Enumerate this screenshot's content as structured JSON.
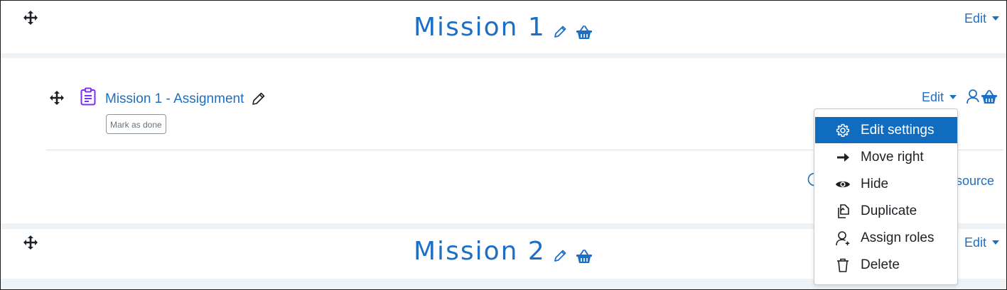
{
  "sections": [
    {
      "title": "Mission 1",
      "edit_label": "Edit"
    },
    {
      "title": "Mission 2",
      "edit_label": "Edit"
    }
  ],
  "activity": {
    "name": "Mission 1 - Assignment",
    "mark_done_label": "Mark as done",
    "edit_label": "Edit"
  },
  "add_activity_partial": "source",
  "edit_menu": {
    "items": [
      {
        "label": "Edit settings",
        "icon": "gear-icon",
        "active": true
      },
      {
        "label": "Move right",
        "icon": "arrow-right-icon"
      },
      {
        "label": "Hide",
        "icon": "eye-icon"
      },
      {
        "label": "Duplicate",
        "icon": "duplicate-icon"
      },
      {
        "label": "Assign roles",
        "icon": "user-plus-icon"
      },
      {
        "label": "Delete",
        "icon": "trash-icon"
      }
    ]
  },
  "colors": {
    "link": "#1d6fc5",
    "menu_active_bg": "#0f6cbf",
    "assignment_icon": "#7b2ff7",
    "strip_bg": "#eef3f8"
  }
}
